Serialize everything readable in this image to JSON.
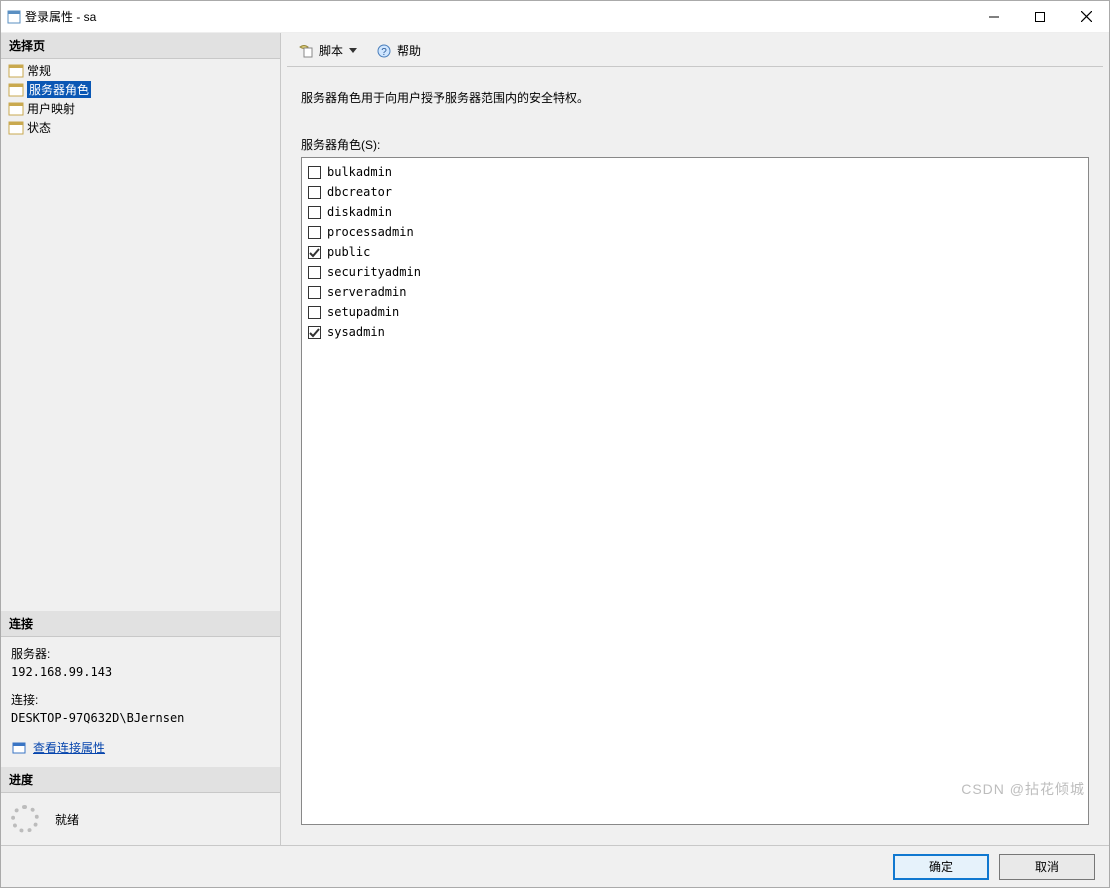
{
  "window": {
    "title": "登录属性 - sa"
  },
  "sidebar": {
    "select_header": "选择页",
    "pages": [
      {
        "label": "常规",
        "selected": false
      },
      {
        "label": "服务器角色",
        "selected": true
      },
      {
        "label": "用户映射",
        "selected": false
      },
      {
        "label": "状态",
        "selected": false
      }
    ],
    "connection_header": "连接",
    "connection": {
      "server_label": "服务器:",
      "server_value": "192.168.99.143",
      "conn_label": "连接:",
      "conn_value": "DESKTOP-97Q632D\\BJernsen",
      "view_props_link": "查看连接属性"
    },
    "progress_header": "进度",
    "progress_status": "就绪"
  },
  "toolbar": {
    "script_label": "脚本",
    "help_label": "帮助"
  },
  "main": {
    "description": "服务器角色用于向用户授予服务器范围内的安全特权。",
    "roles_label": "服务器角色(S):",
    "roles": [
      {
        "name": "bulkadmin",
        "checked": false
      },
      {
        "name": "dbcreator",
        "checked": false
      },
      {
        "name": "diskadmin",
        "checked": false
      },
      {
        "name": "processadmin",
        "checked": false
      },
      {
        "name": "public",
        "checked": true
      },
      {
        "name": "securityadmin",
        "checked": false
      },
      {
        "name": "serveradmin",
        "checked": false
      },
      {
        "name": "setupadmin",
        "checked": false
      },
      {
        "name": "sysadmin",
        "checked": true
      }
    ]
  },
  "footer": {
    "ok_label": "确定",
    "cancel_label": "取消"
  },
  "watermark": "CSDN @拈花倾城"
}
